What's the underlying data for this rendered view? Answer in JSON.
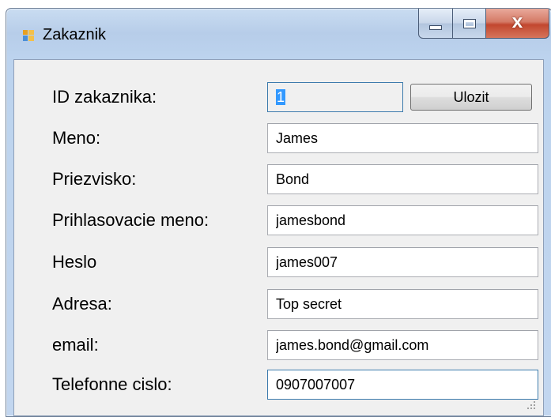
{
  "window": {
    "title": "Zakaznik",
    "icon": "form-icon",
    "caption": {
      "minimize_icon": "minimize-icon",
      "maximize_icon": "maximize-icon",
      "close_label": "X"
    }
  },
  "form": {
    "fields": [
      {
        "key": "id",
        "label": "ID zakaznika:",
        "value": "1",
        "readonly": true
      },
      {
        "key": "meno",
        "label": "Meno:",
        "value": "James"
      },
      {
        "key": "priezvisko",
        "label": "Priezvisko:",
        "value": "Bond"
      },
      {
        "key": "login",
        "label": "Prihlasovacie meno:",
        "value": "jamesbond"
      },
      {
        "key": "heslo",
        "label": "Heslo",
        "value": "james007"
      },
      {
        "key": "adresa",
        "label": "Adresa:",
        "value": "Top secret"
      },
      {
        "key": "email",
        "label": "email:",
        "value": "james.bond@gmail.com"
      },
      {
        "key": "telefon",
        "label": "Telefonne cislo:",
        "value": "0907007007"
      }
    ],
    "save_label": "Ulozit"
  },
  "colors": {
    "titlebar": "#bcd3ee",
    "client_bg": "#f0f0f0",
    "selection": "#3399ff",
    "close_button": "#c2472f"
  }
}
